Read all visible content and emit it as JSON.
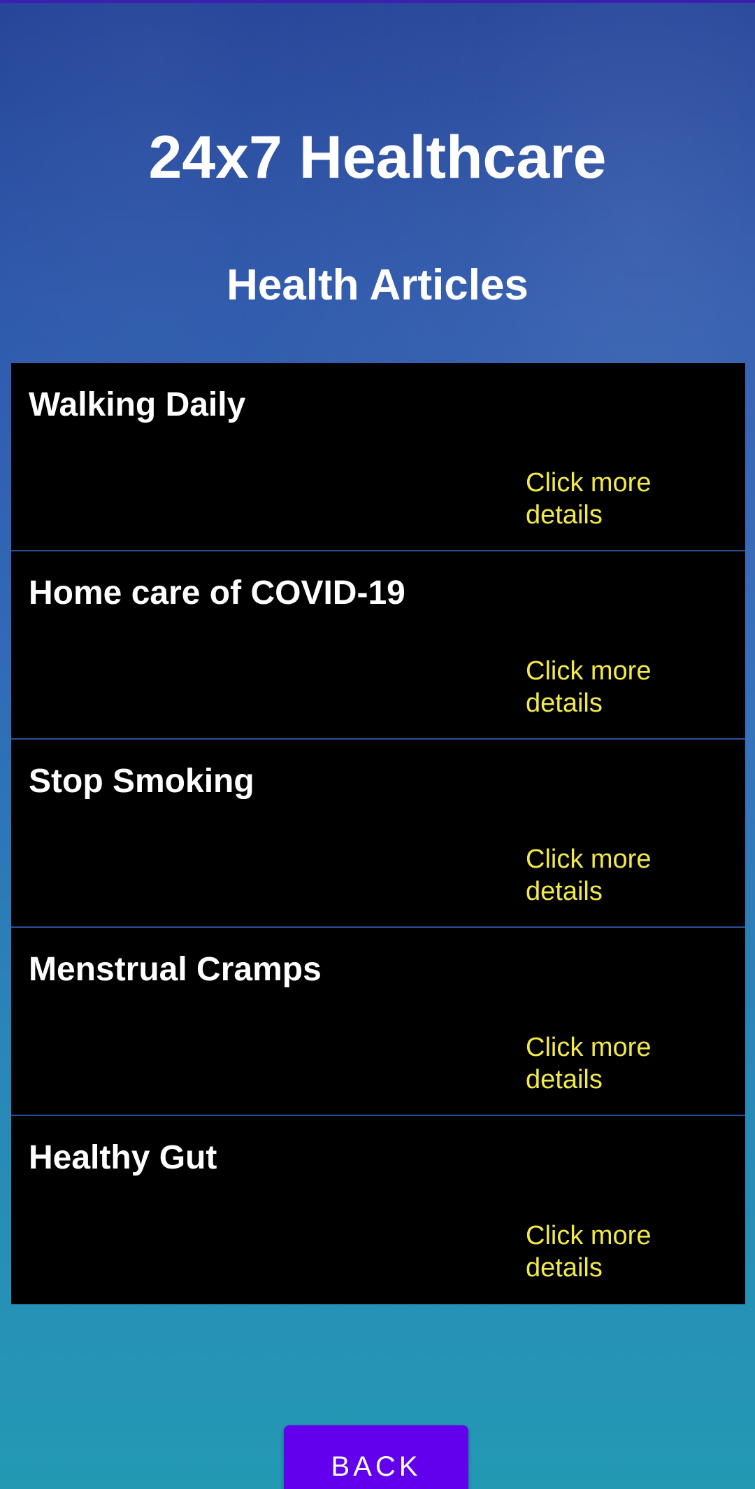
{
  "app": {
    "title": "24x7 Healthcare",
    "section_title": "Health Articles"
  },
  "articles": [
    {
      "title": "Walking Daily",
      "link_text": "Click more details"
    },
    {
      "title": "Home care of COVID-19",
      "link_text": "Click more details"
    },
    {
      "title": "Stop Smoking",
      "link_text": "Click more details"
    },
    {
      "title": "Menstrual Cramps",
      "link_text": "Click more details"
    },
    {
      "title": "Healthy Gut",
      "link_text": "Click more details"
    }
  ],
  "back_button": {
    "label": "BACK"
  },
  "colors": {
    "accent": "#6200ee",
    "link": "#f2e94a",
    "card": "#000000"
  }
}
